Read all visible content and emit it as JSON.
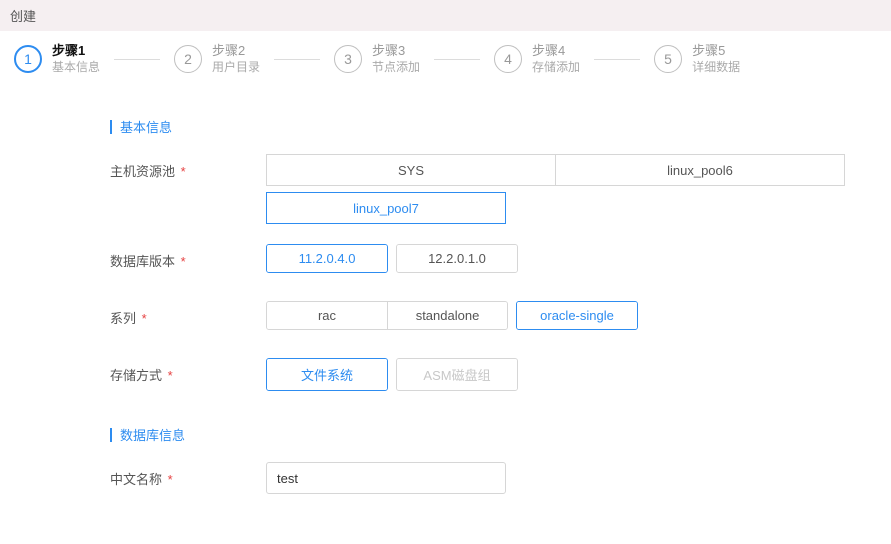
{
  "header": {
    "title": "创建"
  },
  "steps": [
    {
      "num": "1",
      "title": "步骤1",
      "desc": "基本信息",
      "active": true
    },
    {
      "num": "2",
      "title": "步骤2",
      "desc": "用户目录",
      "active": false
    },
    {
      "num": "3",
      "title": "步骤3",
      "desc": "节点添加",
      "active": false
    },
    {
      "num": "4",
      "title": "步骤4",
      "desc": "存储添加",
      "active": false
    },
    {
      "num": "5",
      "title": "步骤5",
      "desc": "详细数据",
      "active": false
    }
  ],
  "sections": {
    "basic": {
      "title": "基本信息"
    },
    "dbinfo": {
      "title": "数据库信息"
    }
  },
  "fields": {
    "hostPool": {
      "label": "主机资源池",
      "options": [
        "SYS",
        "linux_pool6",
        "linux_pool7"
      ],
      "selected": "linux_pool7"
    },
    "dbVersion": {
      "label": "数据库版本",
      "options": [
        "11.2.0.4.0",
        "12.2.0.1.0"
      ],
      "selected": "11.2.0.4.0"
    },
    "series": {
      "label": "系列",
      "options": [
        "rac",
        "standalone",
        "oracle-single"
      ],
      "selected": "oracle-single"
    },
    "storage": {
      "label": "存储方式",
      "options": [
        "文件系统",
        "ASM磁盘组"
      ],
      "selected": "文件系统",
      "disabled": [
        "ASM磁盘组"
      ]
    },
    "cnName": {
      "label": "中文名称",
      "value": "test"
    }
  },
  "required_mark": "*"
}
